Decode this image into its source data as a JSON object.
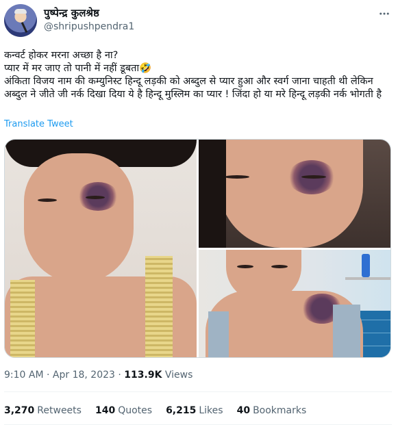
{
  "author": {
    "display_name": "पुष्पेन्द्र कुलश्रेष्ठ",
    "handle": "@shripushpendra1",
    "avatar_icon": "profile-photo"
  },
  "tweet": {
    "lines": [
      "कन्वर्ट होकर मरना अच्छा है ना?",
      "प्यार में मर जाए तो पानी में नहीं डूबता🤣",
      "अंकिता विजय नाम की कम्युनिस्ट हिन्दू लड़की को अब्दुल से प्यार हुआ और स्वर्ग जाना चाहती थी लेकिन अब्दुल ने जीते जी नर्क दिखा दिया ये है हिन्दू मुस्लिम का प्यार ! जिंदा हो या मरे हिन्दू लड़की नर्क भोगती है"
    ],
    "translate_label": "Translate Tweet",
    "time": "9:10 AM",
    "date": "Apr 18, 2023",
    "views_count": "113.9K",
    "views_label": "Views"
  },
  "stats": [
    {
      "count": "3,270",
      "label": "Retweets"
    },
    {
      "count": "140",
      "label": "Quotes"
    },
    {
      "count": "6,215",
      "label": "Likes"
    },
    {
      "count": "40",
      "label": "Bookmarks"
    }
  ],
  "icons": {
    "more": "more-horizontal-icon"
  },
  "colors": {
    "link": "#1d9bf0",
    "secondary_text": "#536471",
    "primary_text": "#0f1419"
  }
}
